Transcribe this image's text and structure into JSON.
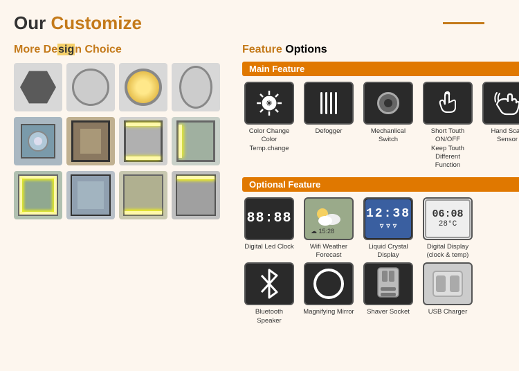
{
  "header": {
    "title_plain": "Our ",
    "title_highlight": "Customize",
    "line": true
  },
  "left": {
    "section_title_plain": "More De",
    "section_title_highlight": "sig",
    "section_title_rest": "n Choice",
    "mirror_rows": [
      [
        "hexagon",
        "circle-plain",
        "circle-lit",
        "oval"
      ],
      [
        "rect-plain",
        "rect-framed",
        "rect-glow",
        "rect-tall"
      ],
      [
        "rect-sq1",
        "rect-sq2",
        "rect-sq3",
        "rect-sq4"
      ]
    ]
  },
  "right": {
    "section_title_highlight": "Feature",
    "section_title_rest": " Options",
    "main_feature_label": "Main Feature",
    "main_features": [
      {
        "icon": "sun",
        "label": "Color Change\nColor Temp.change"
      },
      {
        "icon": "defogger",
        "label": "Defogger"
      },
      {
        "icon": "switch",
        "label": "Mechanlical\nSwitch"
      },
      {
        "icon": "touch",
        "label": "Short Touth ON/OFF\nKeep Touth Different\nFunction"
      },
      {
        "icon": "hand",
        "label": "Hand Scan Sensor"
      }
    ],
    "optional_feature_label": "Optional Feature",
    "optional_features_row1": [
      {
        "icon": "digital-clock",
        "label": "Digital Led Clock"
      },
      {
        "icon": "weather",
        "label": "Wifi Weather Forecast"
      },
      {
        "icon": "lcd",
        "label": "Liquid Crystal Display"
      },
      {
        "icon": "digital-display",
        "label": "Digital Display\n(clock & temp)"
      }
    ],
    "optional_features_row2": [
      {
        "icon": "bluetooth",
        "label": "Bluetooth Speaker"
      },
      {
        "icon": "magnify",
        "label": "Magnifying Mirror"
      },
      {
        "icon": "shaver",
        "label": "Shaver Socket"
      },
      {
        "icon": "usb",
        "label": "USB Charger"
      }
    ]
  },
  "colors": {
    "orange": "#e07800",
    "title_orange": "#c47a1a",
    "dark_bg": "#2a2a2a",
    "page_bg": "#fdf6ee"
  }
}
